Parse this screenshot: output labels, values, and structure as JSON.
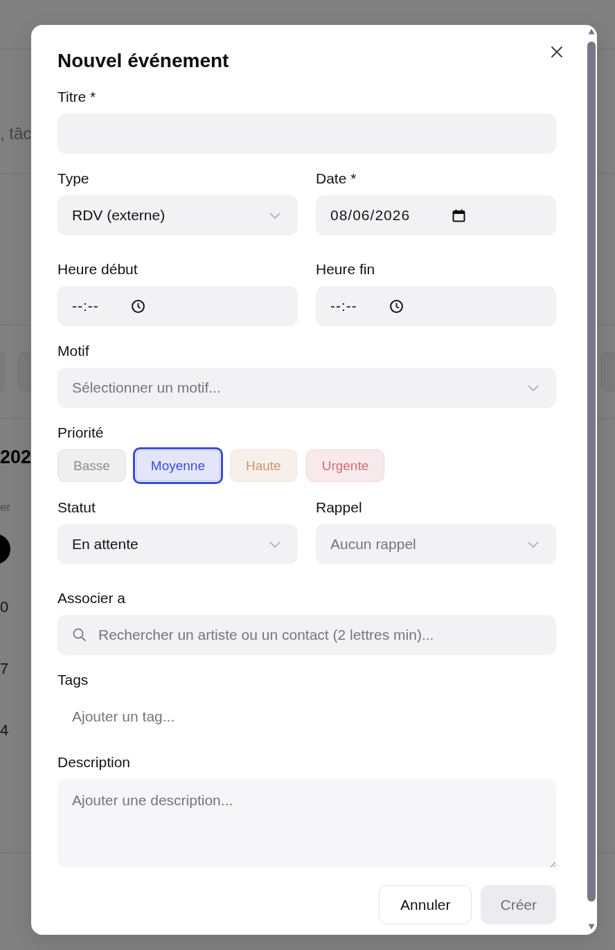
{
  "background_page": {
    "search_text": ", tâc",
    "heading": "202",
    "column_header": "er",
    "cell_numbers": [
      "0",
      "7",
      "4"
    ]
  },
  "dialog": {
    "title": "Nouvel événement",
    "title_field": {
      "label": "Titre *"
    },
    "type": {
      "label": "Type",
      "value": "RDV (externe)"
    },
    "date": {
      "label": "Date *",
      "value": "08/06/2026"
    },
    "start_time": {
      "label": "Heure début",
      "value": "--:--"
    },
    "end_time": {
      "label": "Heure fin",
      "value": "--:--"
    },
    "motif": {
      "label": "Motif",
      "placeholder": "Sélectionner un motif..."
    },
    "priority": {
      "label": "Priorité",
      "options": [
        {
          "label": "Basse",
          "selected": false,
          "color": "#8c8c96"
        },
        {
          "label": "Moyenne",
          "selected": true,
          "color": "#3a4bd6"
        },
        {
          "label": "Haute",
          "selected": false,
          "color": "#c99668"
        },
        {
          "label": "Urgente",
          "selected": false,
          "color": "#d06b76"
        }
      ]
    },
    "status": {
      "label": "Statut",
      "value": "En attente"
    },
    "reminder": {
      "label": "Rappel",
      "placeholder": "Aucun rappel"
    },
    "associate": {
      "label": "Associer a",
      "placeholder": "Rechercher un artiste ou un contact (2 lettres min)..."
    },
    "tags": {
      "label": "Tags",
      "placeholder": "Ajouter un tag..."
    },
    "description": {
      "label": "Description",
      "placeholder": "Ajouter une description..."
    },
    "buttons": [
      {
        "label": "Annuler",
        "kind": "secondary",
        "disabled": false
      },
      {
        "label": "Créer",
        "kind": "primary",
        "disabled": true
      }
    ]
  }
}
